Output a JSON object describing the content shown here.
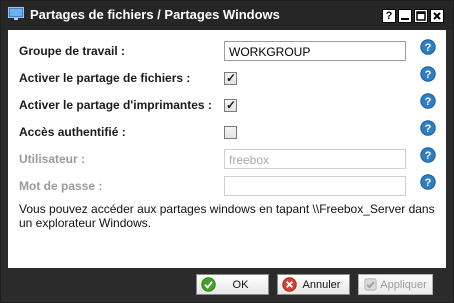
{
  "window": {
    "title": "Partages de fichiers / Partages Windows",
    "controls": {
      "help": "?",
      "minimize": "–",
      "maximize": "□",
      "close": "✕"
    }
  },
  "form": {
    "workgroup_label": "Groupe de travail :",
    "workgroup_value": "WORKGROUP",
    "file_sharing_label": "Activer le partage de fichiers :",
    "file_sharing_checked": true,
    "printer_sharing_label": "Activer le partage d'imprimantes :",
    "printer_sharing_checked": true,
    "auth_label": "Accès authentifié :",
    "auth_checked": false,
    "user_label": "Utilisateur :",
    "user_value": "freebox",
    "password_label": "Mot de passe :",
    "password_value": "",
    "tick_glyph": "✓",
    "description": "Vous pouvez accéder aux partages windows en tapant \\\\Freebox_Server dans un explorateur Windows."
  },
  "buttons": {
    "ok_label": "OK",
    "cancel_label": "Annuler",
    "apply_label": "Appliquer"
  },
  "colors": {
    "title_bar": "#262626",
    "help_icon": "#2e7fc0",
    "ok_icon": "#43a02c",
    "cancel_icon": "#d8412f"
  }
}
